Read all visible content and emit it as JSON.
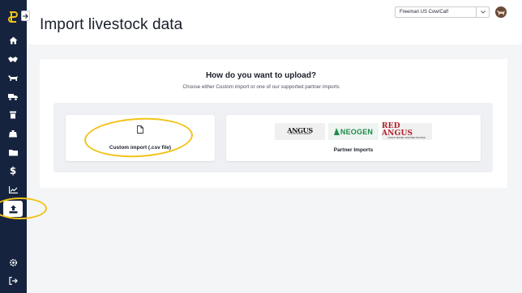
{
  "app": {
    "brand_color": "#16233f",
    "accent_color": "#f2c318"
  },
  "header": {
    "title": "Import livestock data",
    "account_select": {
      "value": "Freeman US Cow/Calf"
    }
  },
  "sidebar": {
    "items": [
      {
        "name": "home",
        "icon": "home-icon",
        "active": false
      },
      {
        "name": "handshake",
        "icon": "handshake-icon",
        "active": false
      },
      {
        "name": "cattle",
        "icon": "cow-icon",
        "active": false
      },
      {
        "name": "transport",
        "icon": "truck-icon",
        "active": false
      },
      {
        "name": "inventory",
        "icon": "bin-icon",
        "active": false
      },
      {
        "name": "feed",
        "icon": "bag-icon",
        "active": false
      },
      {
        "name": "files",
        "icon": "folder-icon",
        "active": false
      },
      {
        "name": "finance",
        "icon": "dollar-icon",
        "active": false
      },
      {
        "name": "reports",
        "icon": "chart-icon",
        "active": false
      },
      {
        "name": "import",
        "icon": "upload-icon",
        "active": true
      },
      {
        "name": "settings",
        "icon": "gear-icon",
        "active": false
      },
      {
        "name": "logout",
        "icon": "logout-icon",
        "active": false
      }
    ]
  },
  "upload": {
    "heading": "How do you want to upload?",
    "subheading": "Choose either Custom import or one of our supported partner imports",
    "custom_label": "Custom import (.csv file)",
    "partner_label": "Partner Imports",
    "partners": [
      {
        "name": "ANGUS",
        "tagline": "THE BUSINESS BREED"
      },
      {
        "name": "NEOGEN"
      },
      {
        "name": "RED ANGUS",
        "tagline": "RANCH-TESTED. RANCHER-TRUSTED."
      }
    ]
  }
}
